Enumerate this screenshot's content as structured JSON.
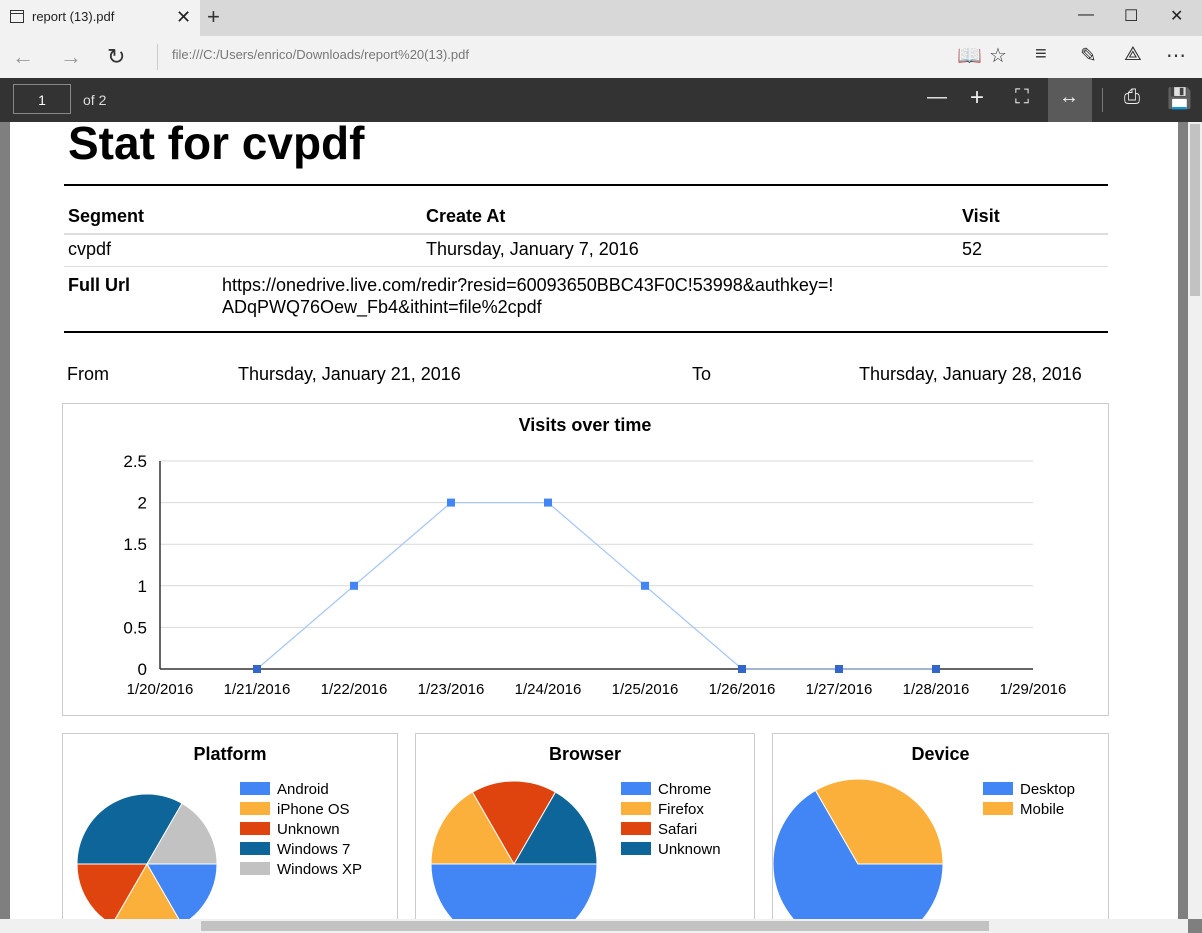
{
  "browser": {
    "tab_title": "report (13).pdf",
    "address": "file:///C:/Users/enrico/Downloads/report%20(13).pdf"
  },
  "pdf_toolbar": {
    "page_number": "1",
    "page_count_label": "of 2"
  },
  "report": {
    "title": "Stat for cvpdf",
    "table": {
      "headers": {
        "segment": "Segment",
        "create_at": "Create At",
        "visit": "Visit"
      },
      "row": {
        "segment": "cvpdf",
        "create_at": "Thursday, January 7, 2016",
        "visit": "52"
      },
      "full_url_label": "Full Url",
      "full_url_line1": "https://onedrive.live.com/redir?resid=60093650BBC43F0C!53998&authkey=!",
      "full_url_line2": "ADqPWQ76Oew_Fb4&ithint=file%2cpdf"
    },
    "range": {
      "from_label": "From",
      "from_value": "Thursday, January 21, 2016",
      "to_label": "To",
      "to_value": "Thursday, January 28, 2016"
    }
  },
  "chart_data": [
    {
      "type": "line",
      "title": "Visits over time",
      "x": [
        "1/20/2016",
        "1/21/2016",
        "1/22/2016",
        "1/23/2016",
        "1/24/2016",
        "1/25/2016",
        "1/26/2016",
        "1/27/2016",
        "1/28/2016",
        "1/29/2016"
      ],
      "series": [
        {
          "x": [
            "1/21/2016",
            "1/22/2016",
            "1/23/2016",
            "1/24/2016",
            "1/25/2016",
            "1/26/2016",
            "1/27/2016",
            "1/28/2016"
          ],
          "values": [
            0,
            1,
            2,
            2,
            1,
            0,
            0,
            0
          ]
        }
      ],
      "ylim": [
        0,
        2.5
      ],
      "yticks": [
        "0",
        "0.5",
        "1",
        "1.5",
        "2",
        "2.5"
      ],
      "grid": true,
      "color": "#4285f4",
      "marker_color": "#3366cc"
    },
    {
      "type": "pie",
      "title": "Platform",
      "legend": "right",
      "slices": [
        {
          "name": "Android",
          "value": 1,
          "color": "#4285f4"
        },
        {
          "name": "iPhone OS",
          "value": 1,
          "color": "#fbb03b"
        },
        {
          "name": "Unknown",
          "value": 1,
          "color": "#e0440e"
        },
        {
          "name": "Windows 7",
          "value": 2,
          "color": "#0e6599"
        },
        {
          "name": "Windows XP",
          "value": 1,
          "color": "#c2c2c2"
        }
      ]
    },
    {
      "type": "pie",
      "title": "Browser",
      "legend": "right",
      "slices": [
        {
          "name": "Chrome",
          "value": 3,
          "color": "#4285f4"
        },
        {
          "name": "Firefox",
          "value": 1,
          "color": "#fbb03b"
        },
        {
          "name": "Safari",
          "value": 1,
          "color": "#e0440e"
        },
        {
          "name": "Unknown",
          "value": 1,
          "color": "#0e6599"
        }
      ]
    },
    {
      "type": "pie",
      "title": "Device",
      "legend": "right",
      "slices": [
        {
          "name": "Desktop",
          "value": 4,
          "color": "#4285f4"
        },
        {
          "name": "Mobile",
          "value": 2,
          "color": "#fbb03b"
        }
      ]
    }
  ]
}
